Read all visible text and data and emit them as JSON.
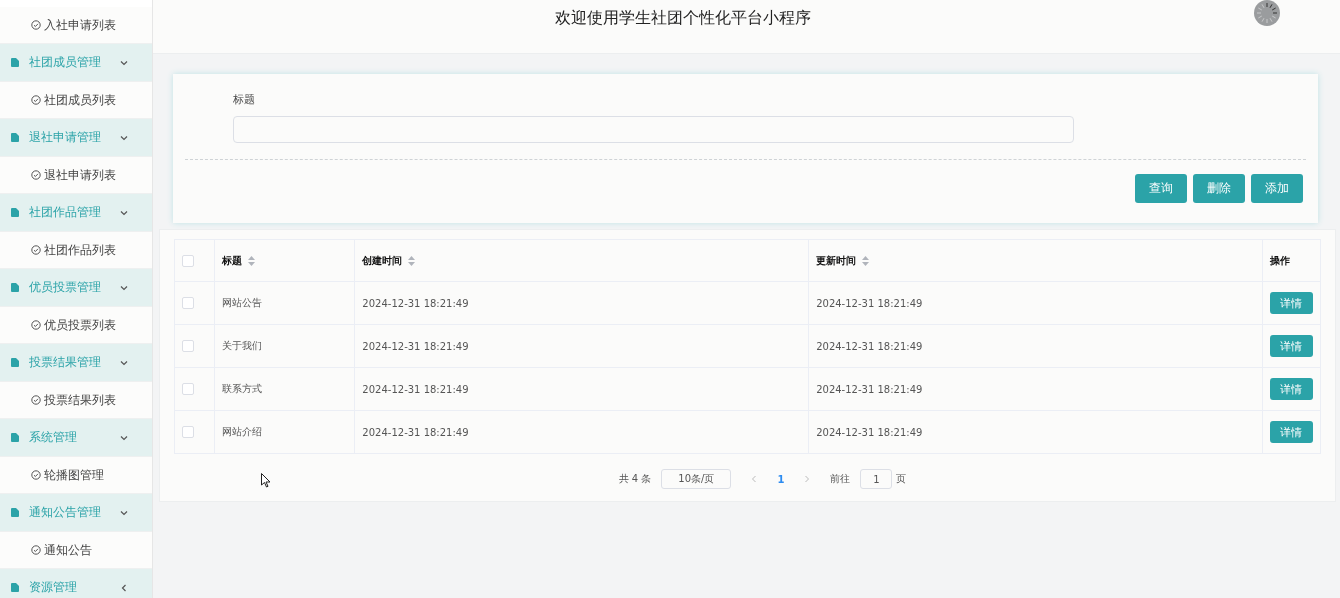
{
  "header": {
    "title": "欢迎使用学生社团个性化平台小程序"
  },
  "sidebar": {
    "items": [
      {
        "kind": "item",
        "label": "入社申请列表"
      },
      {
        "kind": "group",
        "label": "社团成员管理",
        "expanded": true,
        "children": [
          {
            "label": "社团成员列表"
          }
        ]
      },
      {
        "kind": "group",
        "label": "退社申请管理",
        "expanded": true,
        "children": [
          {
            "label": "退社申请列表"
          }
        ]
      },
      {
        "kind": "group",
        "label": "社团作品管理",
        "expanded": true,
        "children": [
          {
            "label": "社团作品列表"
          }
        ]
      },
      {
        "kind": "group",
        "label": "优员投票管理",
        "expanded": true,
        "children": [
          {
            "label": "优员投票列表"
          }
        ]
      },
      {
        "kind": "group",
        "label": "投票结果管理",
        "expanded": true,
        "children": [
          {
            "label": "投票结果列表"
          }
        ]
      },
      {
        "kind": "group",
        "label": "系统管理",
        "expanded": true,
        "children": [
          {
            "label": "轮播图管理"
          }
        ]
      },
      {
        "kind": "group",
        "label": "通知公告管理",
        "expanded": true,
        "children": [
          {
            "label": "通知公告"
          }
        ]
      },
      {
        "kind": "group",
        "label": "资源管理",
        "expanded": false
      }
    ]
  },
  "search": {
    "label": "标题",
    "buttons": [
      "查询",
      "删除",
      "添加"
    ]
  },
  "table": {
    "select_all_checked": false,
    "columns": [
      {
        "label": "标题",
        "sortable": true
      },
      {
        "label": "创建时间",
        "sortable": true
      },
      {
        "label": "更新时间",
        "sortable": true
      },
      {
        "label": "操作",
        "sortable": false
      }
    ],
    "rows": [
      {
        "checked": false,
        "title": "网站公告",
        "created": "2024-12-31 18:21:49",
        "updated": "2024-12-31 18:21:49",
        "action": "详情"
      },
      {
        "checked": false,
        "title": "关于我们",
        "created": "2024-12-31 18:21:49",
        "updated": "2024-12-31 18:21:49",
        "action": "详情"
      },
      {
        "checked": false,
        "title": "联系方式",
        "created": "2024-12-31 18:21:49",
        "updated": "2024-12-31 18:21:49",
        "action": "详情"
      },
      {
        "checked": false,
        "title": "网站介绍",
        "created": "2024-12-31 18:21:49",
        "updated": "2024-12-31 18:21:49",
        "action": "详情"
      }
    ]
  },
  "pagination": {
    "total": "共 4 条",
    "page_size": "10条/页",
    "pages": [
      {
        "label": "1",
        "selected": true
      }
    ],
    "goto_label": "前往",
    "goto_value": "1",
    "goto_suffix": "页"
  }
}
